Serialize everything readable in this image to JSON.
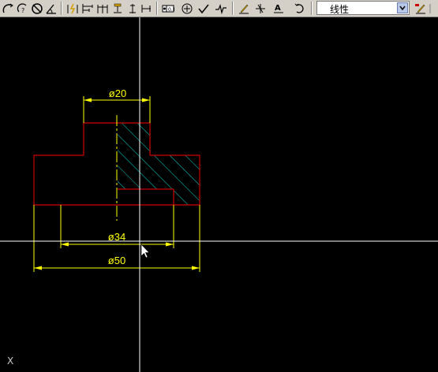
{
  "toolbar": {
    "buttons": [
      "arc-tool-icon",
      "circle-slash-icon",
      "angle-dimension-icon",
      "quick-dimension-icon",
      "baseline-dimension-icon",
      "continue-dimension-icon",
      "leader-icon",
      "tolerance-icon",
      "center-mark-icon",
      "check-icon",
      "break-icon",
      "dim-edit-icon",
      "dim-text-edit-icon",
      "dim-update-icon",
      "dim-style-icon"
    ],
    "dim_style": {
      "value": "线性"
    }
  },
  "drawing": {
    "dimensions": {
      "top": "ø20",
      "mid": "ø34",
      "bottom": "ø50"
    },
    "ucs_label": "X",
    "colors": {
      "background": "#000000",
      "outline": "#cc0000",
      "dimension": "#ffff00",
      "hatch": "#00d4d4",
      "crosshair": "#ffffff"
    }
  }
}
